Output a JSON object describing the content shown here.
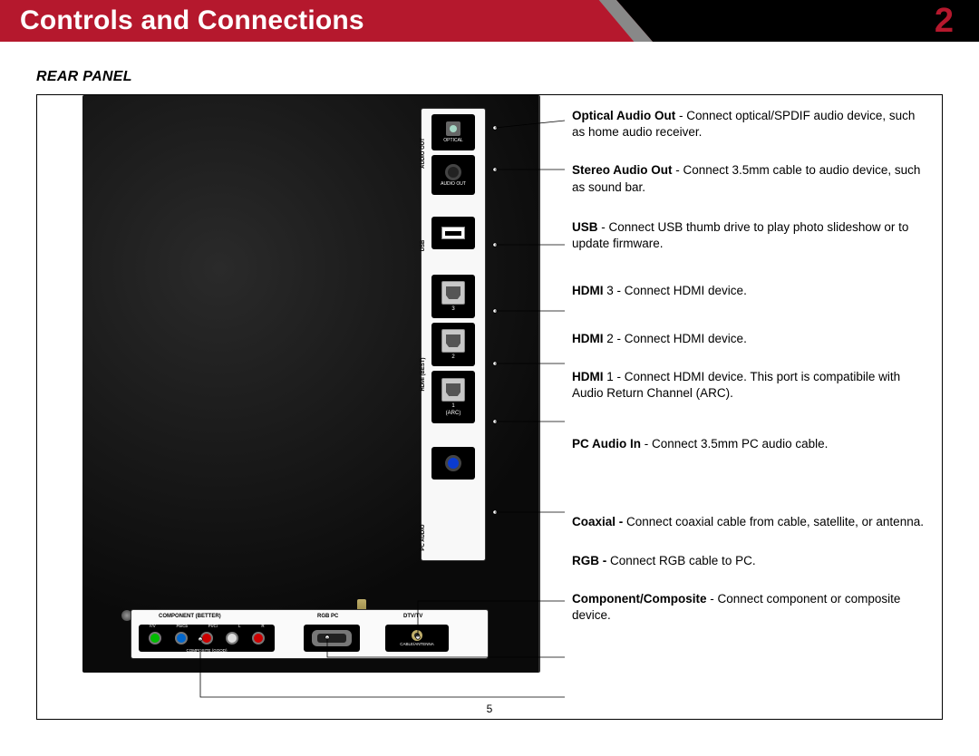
{
  "header": {
    "title": "Controls and Connections",
    "chapter": "2"
  },
  "section_title": "REAR PANEL",
  "page_number": "5",
  "side_panel": {
    "group_audio": "AUDIO OUT",
    "group_usb": "USB",
    "group_hdmi": "HDMI (BEST)",
    "group_pcaudio": "PC AUDIO",
    "optical_label": "OPTICAL",
    "audio_out_label": "AUDIO OUT",
    "hdmi3": "3",
    "hdmi2": "2",
    "hdmi1": "1",
    "hdmi1_arc": "(ARC)"
  },
  "bottom_panel": {
    "component_label": "COMPONENT (BETTER)",
    "composite_label": "COMPOSITE (GOOD)",
    "rgb_label": "RGB PC",
    "dtv_label": "DTV/TV",
    "cable_label": "CABLE/ANTENNA",
    "rca_yv": "Y/V",
    "rca_pb": "Pb/Cb",
    "rca_pr": "Pr/Cr",
    "rca_l": "L",
    "rca_r": "R"
  },
  "descriptions": {
    "optical": {
      "bold": "Optical Audio Out",
      "text": " - Connect optical/SPDIF audio device, such as home audio receiver."
    },
    "stereo": {
      "bold": "Stereo Audio Out",
      "text": " - Connect 3.5mm cable to audio device, such as sound bar."
    },
    "usb": {
      "bold": "USB",
      "text": " - Connect USB thumb drive to play photo slideshow or to update firmware."
    },
    "hdmi3": {
      "bold": "HDMI",
      "mid": " 3",
      "text": " - Connect HDMI device."
    },
    "hdmi2": {
      "bold": "HDMI",
      "mid": " 2",
      "text": " - Connect HDMI device."
    },
    "hdmi1": {
      "bold": "HDMI",
      "mid": " 1",
      "text": " - Connect HDMI device. This port is compatibile with Audio Return Channel (ARC)."
    },
    "pcaudio": {
      "bold": "PC Audio In",
      "text": " - Connect 3.5mm PC audio cable."
    },
    "coax": {
      "bold": "Coaxial - ",
      "text": "Connect coaxial cable from cable, satellite, or antenna."
    },
    "rgb": {
      "bold": "RGB - ",
      "text": "Connect RGB cable to PC."
    },
    "comp": {
      "bold": "Component/Composite",
      "text": " - Connect component or composite device."
    }
  }
}
